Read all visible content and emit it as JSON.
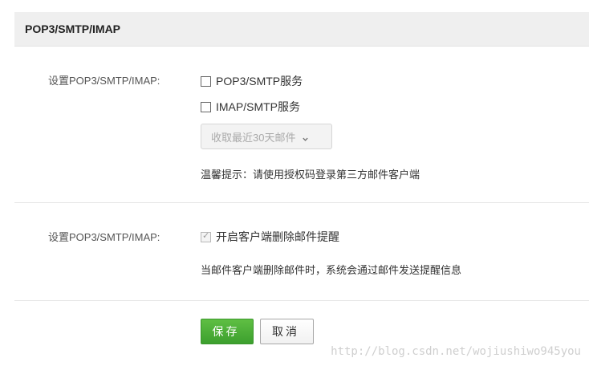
{
  "header": {
    "title": "POP3/SMTP/IMAP"
  },
  "section_protocols": {
    "label": "设置POP3/SMTP/IMAP:",
    "options": [
      {
        "label": "POP3/SMTP服务",
        "checked": false
      },
      {
        "label": "IMAP/SMTP服务",
        "checked": false
      }
    ],
    "receive_select": {
      "value": "收取最近30天邮件",
      "disabled": true
    },
    "hint": "温馨提示：请使用授权码登录第三方邮件客户端"
  },
  "section_delete_notice": {
    "label": "设置POP3/SMTP/IMAP:",
    "option": {
      "label": "开启客户端删除邮件提醒",
      "checked": true,
      "disabled": true
    },
    "hint": "当邮件客户端删除邮件时，系统会通过邮件发送提醒信息"
  },
  "actions": {
    "save_label": "保存",
    "cancel_label": "取消"
  },
  "watermark": "http://blog.csdn.net/wojiushiwo945you",
  "colors": {
    "header_bg": "#efefef",
    "save_button": "#4cae38",
    "disabled_select_bg": "#f3f3f3"
  },
  "icons": {
    "select_arrow": "chevron-down-icon",
    "check": "checkmark-icon"
  }
}
